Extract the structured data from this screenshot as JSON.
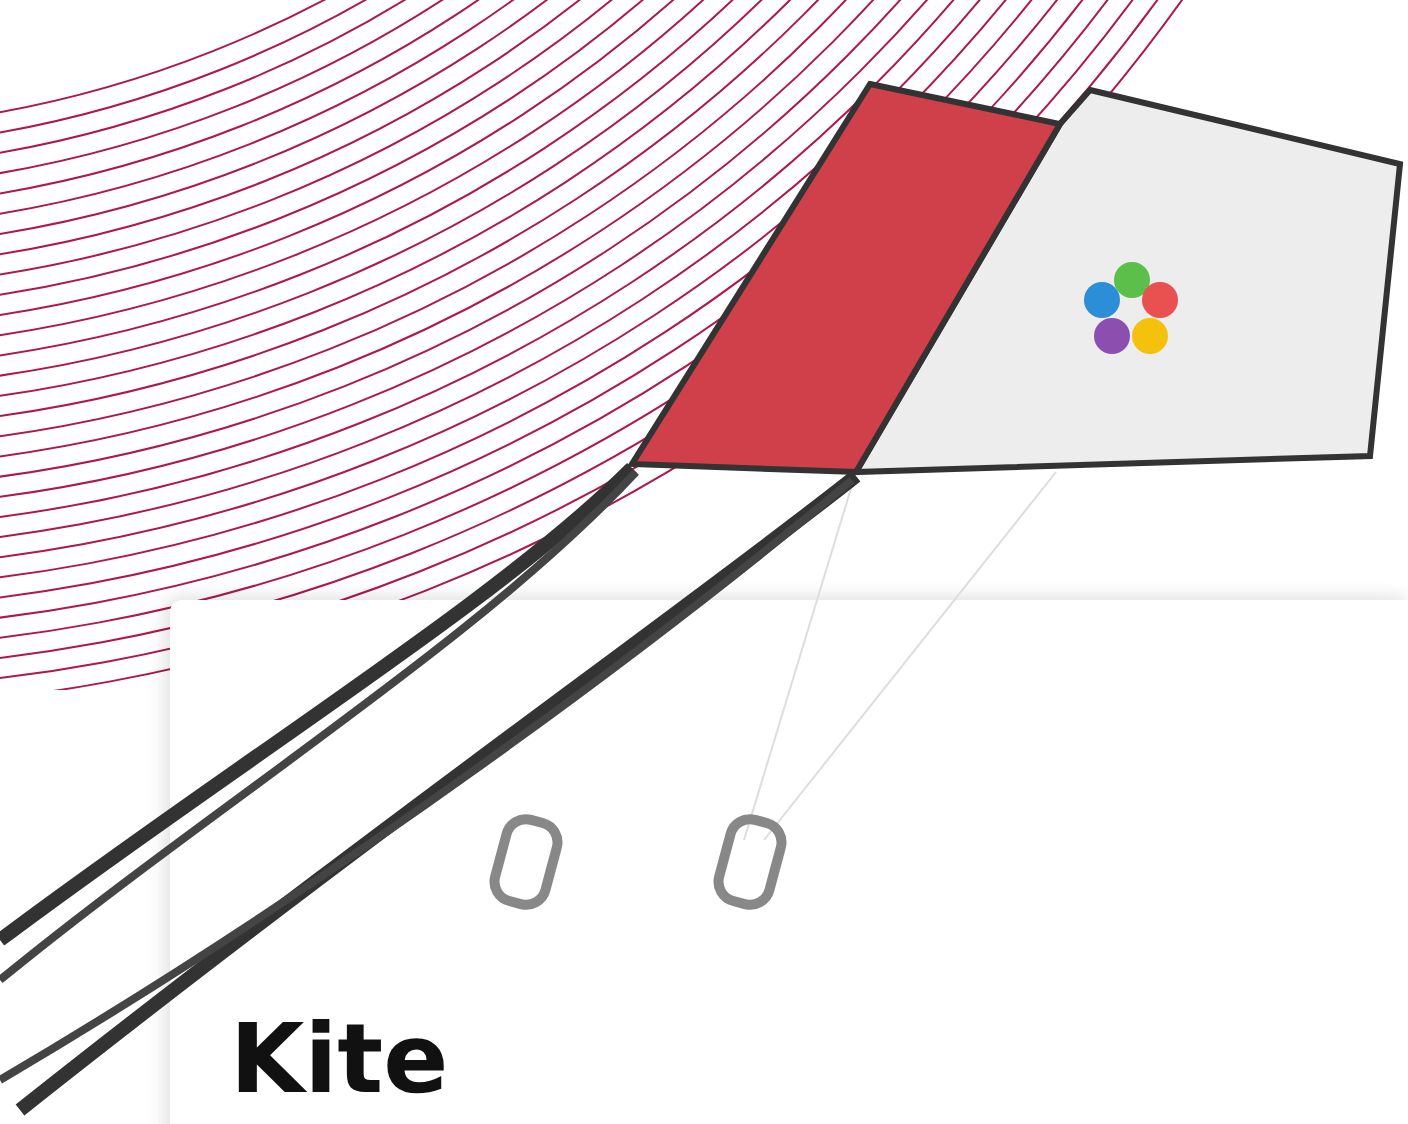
{
  "card": {
    "heading": "Kite"
  }
}
